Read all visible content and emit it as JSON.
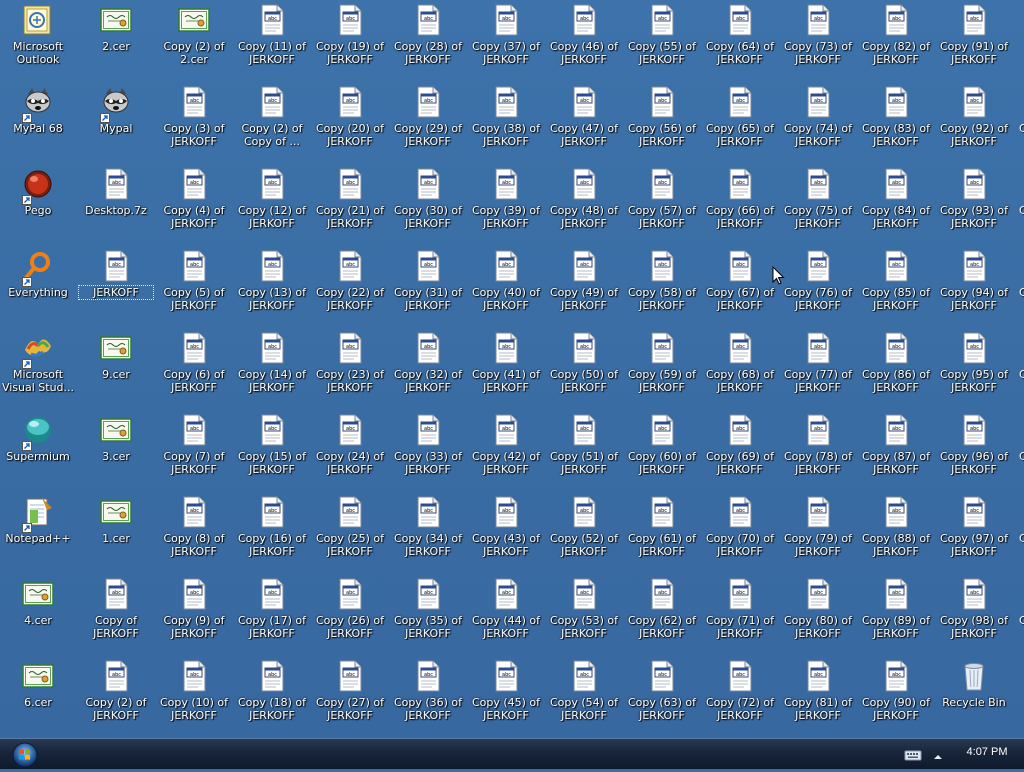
{
  "desktop": {
    "icons": [
      {
        "label": "Microsoft Outlook",
        "icon": "outlook-icon",
        "shortcut": false
      },
      {
        "label": "2.cer",
        "icon": "certificate-icon",
        "shortcut": false
      },
      {
        "label": "Copy (2) of 2.cer",
        "icon": "certificate-icon",
        "shortcut": false
      },
      {
        "label": "Copy (11) of JERKOFF",
        "icon": "file-icon",
        "shortcut": false
      },
      {
        "label": "Copy (19) of JERKOFF",
        "icon": "file-icon",
        "shortcut": false
      },
      {
        "label": "Copy (28) of JERKOFF",
        "icon": "file-icon",
        "shortcut": false
      },
      {
        "label": "Copy (37) of JERKOFF",
        "icon": "file-icon",
        "shortcut": false
      },
      {
        "label": "Copy (46) of JERKOFF",
        "icon": "file-icon",
        "shortcut": false
      },
      {
        "label": "Copy (55) of JERKOFF",
        "icon": "file-icon",
        "shortcut": false
      },
      {
        "label": "Copy (64) of JERKOFF",
        "icon": "file-icon",
        "shortcut": false
      },
      {
        "label": "Copy (73) of JERKOFF",
        "icon": "file-icon",
        "shortcut": false
      },
      {
        "label": "Copy (82) of JERKOFF",
        "icon": "file-icon",
        "shortcut": false
      },
      {
        "label": "Copy (91) of JERKOFF",
        "icon": "file-icon",
        "shortcut": false
      },
      {
        "label": "MyPal 68",
        "icon": "raccoon-icon",
        "shortcut": true
      },
      {
        "label": "Mypal",
        "icon": "raccoon-icon",
        "shortcut": true
      },
      {
        "label": "Copy (3) of JERKOFF",
        "icon": "file-icon",
        "shortcut": false
      },
      {
        "label": "Copy (2) of Copy of ...",
        "icon": "file-icon",
        "shortcut": false
      },
      {
        "label": "Copy (20) of JERKOFF",
        "icon": "file-icon",
        "shortcut": false
      },
      {
        "label": "Copy (29) of JERKOFF",
        "icon": "file-icon",
        "shortcut": false
      },
      {
        "label": "Copy (38) of JERKOFF",
        "icon": "file-icon",
        "shortcut": false
      },
      {
        "label": "Copy (47) of JERKOFF",
        "icon": "file-icon",
        "shortcut": false
      },
      {
        "label": "Copy (56) of JERKOFF",
        "icon": "file-icon",
        "shortcut": false
      },
      {
        "label": "Copy (65) of JERKOFF",
        "icon": "file-icon",
        "shortcut": false
      },
      {
        "label": "Copy (74) of JERKOFF",
        "icon": "file-icon",
        "shortcut": false
      },
      {
        "label": "Copy (83) of JERKOFF",
        "icon": "file-icon",
        "shortcut": false
      },
      {
        "label": "Copy (92) of JERKOFF",
        "icon": "file-icon",
        "shortcut": false
      },
      {
        "label": "Pego",
        "icon": "pego-icon",
        "shortcut": true
      },
      {
        "label": "Desktop.7z",
        "icon": "file-icon",
        "shortcut": false
      },
      {
        "label": "Copy (4) of JERKOFF",
        "icon": "file-icon",
        "shortcut": false
      },
      {
        "label": "Copy (12) of JERKOFF",
        "icon": "file-icon",
        "shortcut": false
      },
      {
        "label": "Copy (21) of JERKOFF",
        "icon": "file-icon",
        "shortcut": false
      },
      {
        "label": "Copy (30) of JERKOFF",
        "icon": "file-icon",
        "shortcut": false
      },
      {
        "label": "Copy (39) of JERKOFF",
        "icon": "file-icon",
        "shortcut": false
      },
      {
        "label": "Copy (48) of JERKOFF",
        "icon": "file-icon",
        "shortcut": false
      },
      {
        "label": "Copy (57) of JERKOFF",
        "icon": "file-icon",
        "shortcut": false
      },
      {
        "label": "Copy (66) of JERKOFF",
        "icon": "file-icon",
        "shortcut": false
      },
      {
        "label": "Copy (75) of JERKOFF",
        "icon": "file-icon",
        "shortcut": false
      },
      {
        "label": "Copy (84) of JERKOFF",
        "icon": "file-icon",
        "shortcut": false
      },
      {
        "label": "Copy (93) of JERKOFF",
        "icon": "file-icon",
        "shortcut": false
      },
      {
        "label": "Everything",
        "icon": "everything-search-icon",
        "shortcut": true
      },
      {
        "label": "JERKOFF",
        "icon": "file-icon",
        "shortcut": false,
        "selected": true
      },
      {
        "label": "Copy (5) of JERKOFF",
        "icon": "file-icon",
        "shortcut": false
      },
      {
        "label": "Copy (13) of JERKOFF",
        "icon": "file-icon",
        "shortcut": false
      },
      {
        "label": "Copy (22) of JERKOFF",
        "icon": "file-icon",
        "shortcut": false
      },
      {
        "label": "Copy (31) of JERKOFF",
        "icon": "file-icon",
        "shortcut": false
      },
      {
        "label": "Copy (40) of JERKOFF",
        "icon": "file-icon",
        "shortcut": false
      },
      {
        "label": "Copy (49) of JERKOFF",
        "icon": "file-icon",
        "shortcut": false
      },
      {
        "label": "Copy (58) of JERKOFF",
        "icon": "file-icon",
        "shortcut": false
      },
      {
        "label": "Copy (67) of JERKOFF",
        "icon": "file-icon",
        "shortcut": false
      },
      {
        "label": "Copy (76) of JERKOFF",
        "icon": "file-icon",
        "shortcut": false
      },
      {
        "label": "Copy (85) of JERKOFF",
        "icon": "file-icon",
        "shortcut": false
      },
      {
        "label": "Copy (94) of JERKOFF",
        "icon": "file-icon",
        "shortcut": false
      },
      {
        "label": "Microsoft Visual Stud...",
        "icon": "visual-studio-icon",
        "shortcut": true
      },
      {
        "label": "9.cer",
        "icon": "certificate-icon",
        "shortcut": false
      },
      {
        "label": "Copy (6) of JERKOFF",
        "icon": "file-icon",
        "shortcut": false
      },
      {
        "label": "Copy (14) of JERKOFF",
        "icon": "file-icon",
        "shortcut": false
      },
      {
        "label": "Copy (23) of JERKOFF",
        "icon": "file-icon",
        "shortcut": false
      },
      {
        "label": "Copy (32) of JERKOFF",
        "icon": "file-icon",
        "shortcut": false
      },
      {
        "label": "Copy (41) of JERKOFF",
        "icon": "file-icon",
        "shortcut": false
      },
      {
        "label": "Copy (50) of JERKOFF",
        "icon": "file-icon",
        "shortcut": false
      },
      {
        "label": "Copy (59) of JERKOFF",
        "icon": "file-icon",
        "shortcut": false
      },
      {
        "label": "Copy (68) of JERKOFF",
        "icon": "file-icon",
        "shortcut": false
      },
      {
        "label": "Copy (77) of JERKOFF",
        "icon": "file-icon",
        "shortcut": false
      },
      {
        "label": "Copy (86) of JERKOFF",
        "icon": "file-icon",
        "shortcut": false
      },
      {
        "label": "Copy (95) of JERKOFF",
        "icon": "file-icon",
        "shortcut": false
      },
      {
        "label": "Supermium",
        "icon": "supermium-icon",
        "shortcut": true
      },
      {
        "label": "3.cer",
        "icon": "certificate-icon",
        "shortcut": false
      },
      {
        "label": "Copy (7) of JERKOFF",
        "icon": "file-icon",
        "shortcut": false
      },
      {
        "label": "Copy (15) of JERKOFF",
        "icon": "file-icon",
        "shortcut": false
      },
      {
        "label": "Copy (24) of JERKOFF",
        "icon": "file-icon",
        "shortcut": false
      },
      {
        "label": "Copy (33) of JERKOFF",
        "icon": "file-icon",
        "shortcut": false
      },
      {
        "label": "Copy (42) of JERKOFF",
        "icon": "file-icon",
        "shortcut": false
      },
      {
        "label": "Copy (51) of JERKOFF",
        "icon": "file-icon",
        "shortcut": false
      },
      {
        "label": "Copy (60) of JERKOFF",
        "icon": "file-icon",
        "shortcut": false
      },
      {
        "label": "Copy (69) of JERKOFF",
        "icon": "file-icon",
        "shortcut": false
      },
      {
        "label": "Copy (78) of JERKOFF",
        "icon": "file-icon",
        "shortcut": false
      },
      {
        "label": "Copy (87) of JERKOFF",
        "icon": "file-icon",
        "shortcut": false
      },
      {
        "label": "Copy (96) of JERKOFF",
        "icon": "file-icon",
        "shortcut": false
      },
      {
        "label": "Notepad++",
        "icon": "notepad-plus-plus-icon",
        "shortcut": true
      },
      {
        "label": "1.cer",
        "icon": "certificate-icon",
        "shortcut": false
      },
      {
        "label": "Copy (8) of JERKOFF",
        "icon": "file-icon",
        "shortcut": false
      },
      {
        "label": "Copy (16) of JERKOFF",
        "icon": "file-icon",
        "shortcut": false
      },
      {
        "label": "Copy (25) of JERKOFF",
        "icon": "file-icon",
        "shortcut": false
      },
      {
        "label": "Copy (34) of JERKOFF",
        "icon": "file-icon",
        "shortcut": false
      },
      {
        "label": "Copy (43) of JERKOFF",
        "icon": "file-icon",
        "shortcut": false
      },
      {
        "label": "Copy (52) of JERKOFF",
        "icon": "file-icon",
        "shortcut": false
      },
      {
        "label": "Copy (61) of JERKOFF",
        "icon": "file-icon",
        "shortcut": false
      },
      {
        "label": "Copy (70) of JERKOFF",
        "icon": "file-icon",
        "shortcut": false
      },
      {
        "label": "Copy (79) of JERKOFF",
        "icon": "file-icon",
        "shortcut": false
      },
      {
        "label": "Copy (88) of JERKOFF",
        "icon": "file-icon",
        "shortcut": false
      },
      {
        "label": "Copy (97) of JERKOFF",
        "icon": "file-icon",
        "shortcut": false
      },
      {
        "label": "4.cer",
        "icon": "certificate-icon",
        "shortcut": false
      },
      {
        "label": "Copy of JERKOFF",
        "icon": "file-icon",
        "shortcut": false
      },
      {
        "label": "Copy (9) of JERKOFF",
        "icon": "file-icon",
        "shortcut": false
      },
      {
        "label": "Copy (17) of JERKOFF",
        "icon": "file-icon",
        "shortcut": false
      },
      {
        "label": "Copy (26) of JERKOFF",
        "icon": "file-icon",
        "shortcut": false
      },
      {
        "label": "Copy (35) of JERKOFF",
        "icon": "file-icon",
        "shortcut": false
      },
      {
        "label": "Copy (44) of JERKOFF",
        "icon": "file-icon",
        "shortcut": false
      },
      {
        "label": "Copy (53) of JERKOFF",
        "icon": "file-icon",
        "shortcut": false
      },
      {
        "label": "Copy (62) of JERKOFF",
        "icon": "file-icon",
        "shortcut": false
      },
      {
        "label": "Copy (71) of JERKOFF",
        "icon": "file-icon",
        "shortcut": false
      },
      {
        "label": "Copy (80) of JERKOFF",
        "icon": "file-icon",
        "shortcut": false
      },
      {
        "label": "Copy (89) of JERKOFF",
        "icon": "file-icon",
        "shortcut": false
      },
      {
        "label": "Copy (98) of JERKOFF",
        "icon": "file-icon",
        "shortcut": false
      },
      {
        "label": "6.cer",
        "icon": "certificate-icon",
        "shortcut": false
      },
      {
        "label": "Copy (2) of JERKOFF",
        "icon": "file-icon",
        "shortcut": false
      },
      {
        "label": "Copy (10) of JERKOFF",
        "icon": "file-icon",
        "shortcut": false
      },
      {
        "label": "Copy (18) of JERKOFF",
        "icon": "file-icon",
        "shortcut": false
      },
      {
        "label": "Copy (27) of JERKOFF",
        "icon": "file-icon",
        "shortcut": false
      },
      {
        "label": "Copy (36) of JERKOFF",
        "icon": "file-icon",
        "shortcut": false
      },
      {
        "label": "Copy (45) of JERKOFF",
        "icon": "file-icon",
        "shortcut": false
      },
      {
        "label": "Copy (54) of JERKOFF",
        "icon": "file-icon",
        "shortcut": false
      },
      {
        "label": "Copy (63) of JERKOFF",
        "icon": "file-icon",
        "shortcut": false
      },
      {
        "label": "Copy (72) of JERKOFF",
        "icon": "file-icon",
        "shortcut": false
      },
      {
        "label": "Copy (81) of JERKOFF",
        "icon": "file-icon",
        "shortcut": false
      },
      {
        "label": "Copy (90) of JERKOFF",
        "icon": "file-icon",
        "shortcut": false
      },
      {
        "label": "Recycle Bin",
        "icon": "recycle-bin-icon",
        "shortcut": false
      }
    ]
  },
  "taskbar": {
    "start_icon": "windows-start-orb-icon",
    "tray": {
      "keyboard_icon": "keyboard-icon",
      "show_hidden_icon": "chevron-up-icon",
      "clock": "4:07 PM"
    }
  },
  "colors": {
    "desktop": "#3a6ea5",
    "label_text": "#ffffff",
    "taskbar": "#18253a"
  }
}
